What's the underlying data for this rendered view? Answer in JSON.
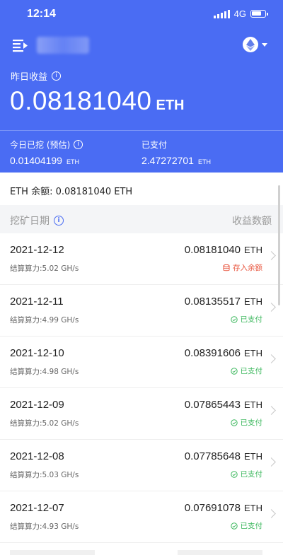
{
  "status_bar": {
    "time": "12:14",
    "network": "4G"
  },
  "header": {
    "coin_icon": "ethereum-icon"
  },
  "summary": {
    "yesterday_label": "昨日收益",
    "yesterday_value": "0.08181040",
    "yesterday_unit": "ETH",
    "today_label": "今日已挖 (预估)",
    "today_value": "0.01404199",
    "today_unit": "ETH",
    "paid_label": "已支付",
    "paid_value": "2.47272701",
    "paid_unit": "ETH"
  },
  "balance_text": "ETH 余额: 0.08181040 ETH",
  "list_header": {
    "date_label": "挖矿日期",
    "amount_label": "收益数额"
  },
  "colors": {
    "primary": "#4a6cf3",
    "paid": "#3db85e",
    "deposit": "#e8553e"
  },
  "rows": [
    {
      "date": "2021-12-12",
      "hashrate": "结算算力:5.02 GH/s",
      "amount": "0.08181040",
      "unit": "ETH",
      "status": "存入余额",
      "status_type": "deposit"
    },
    {
      "date": "2021-12-11",
      "hashrate": "结算算力:4.99 GH/s",
      "amount": "0.08135517",
      "unit": "ETH",
      "status": "已支付",
      "status_type": "paid"
    },
    {
      "date": "2021-12-10",
      "hashrate": "结算算力:4.98 GH/s",
      "amount": "0.08391606",
      "unit": "ETH",
      "status": "已支付",
      "status_type": "paid"
    },
    {
      "date": "2021-12-09",
      "hashrate": "结算算力:5.02 GH/s",
      "amount": "0.07865443",
      "unit": "ETH",
      "status": "已支付",
      "status_type": "paid"
    },
    {
      "date": "2021-12-08",
      "hashrate": "结算算力:5.03 GH/s",
      "amount": "0.07785648",
      "unit": "ETH",
      "status": "已支付",
      "status_type": "paid"
    },
    {
      "date": "2021-12-07",
      "hashrate": "结算算力:4.93 GH/s",
      "amount": "0.07691078",
      "unit": "ETH",
      "status": "已支付",
      "status_type": "paid"
    }
  ]
}
